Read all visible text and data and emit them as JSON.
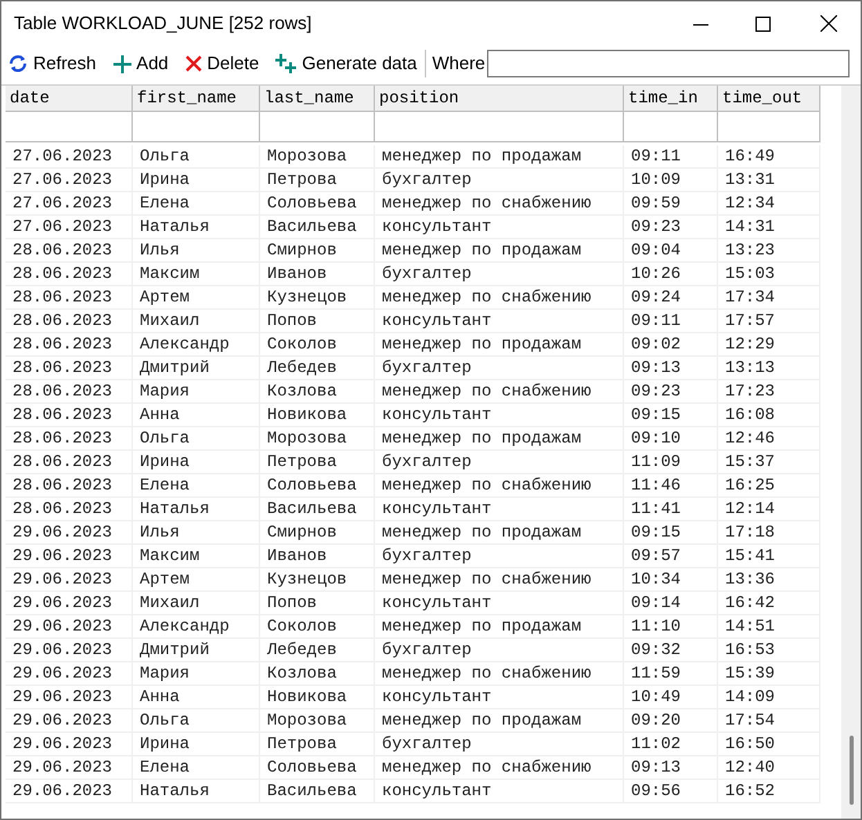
{
  "window": {
    "title": "Table WORKLOAD_JUNE [252 rows]"
  },
  "toolbar": {
    "buttons": [
      {
        "kind": "refresh",
        "label": "Refresh"
      },
      {
        "kind": "add",
        "label": "Add"
      },
      {
        "kind": "delete",
        "label": "Delete"
      },
      {
        "kind": "generate",
        "label": "Generate data"
      }
    ],
    "where_label": "Where"
  },
  "table": {
    "columns": [
      "date",
      "first_name",
      "last_name",
      "position",
      "time_in",
      "time_out"
    ],
    "rows": [
      [
        "27.06.2023",
        "Ольга",
        "Морозова",
        "менеджер по продажам",
        "09:11",
        "16:49"
      ],
      [
        "27.06.2023",
        "Ирина",
        "Петрова",
        "бухгалтер",
        "10:09",
        "13:31"
      ],
      [
        "27.06.2023",
        "Елена",
        "Соловьева",
        "менеджер по снабжению",
        "09:59",
        "12:34"
      ],
      [
        "27.06.2023",
        "Наталья",
        "Васильева",
        "консультант",
        "09:23",
        "14:31"
      ],
      [
        "28.06.2023",
        "Илья",
        "Смирнов",
        "менеджер по продажам",
        "09:04",
        "13:23"
      ],
      [
        "28.06.2023",
        "Максим",
        "Иванов",
        "бухгалтер",
        "10:26",
        "15:03"
      ],
      [
        "28.06.2023",
        "Артем",
        "Кузнецов",
        "менеджер по снабжению",
        "09:24",
        "17:34"
      ],
      [
        "28.06.2023",
        "Михаил",
        "Попов",
        "консультант",
        "09:11",
        "17:57"
      ],
      [
        "28.06.2023",
        "Александр",
        "Соколов",
        "менеджер по продажам",
        "09:02",
        "12:29"
      ],
      [
        "28.06.2023",
        "Дмитрий",
        "Лебедев",
        "бухгалтер",
        "09:13",
        "13:13"
      ],
      [
        "28.06.2023",
        "Мария",
        "Козлова",
        "менеджер по снабжению",
        "09:23",
        "17:23"
      ],
      [
        "28.06.2023",
        "Анна",
        "Новикова",
        "консультант",
        "09:15",
        "16:08"
      ],
      [
        "28.06.2023",
        "Ольга",
        "Морозова",
        "менеджер по продажам",
        "09:10",
        "12:46"
      ],
      [
        "28.06.2023",
        "Ирина",
        "Петрова",
        "бухгалтер",
        "11:09",
        "15:37"
      ],
      [
        "28.06.2023",
        "Елена",
        "Соловьева",
        "менеджер по снабжению",
        "11:46",
        "16:25"
      ],
      [
        "28.06.2023",
        "Наталья",
        "Васильева",
        "консультант",
        "11:41",
        "12:14"
      ],
      [
        "29.06.2023",
        "Илья",
        "Смирнов",
        "менеджер по продажам",
        "09:15",
        "17:18"
      ],
      [
        "29.06.2023",
        "Максим",
        "Иванов",
        "бухгалтер",
        "09:57",
        "15:41"
      ],
      [
        "29.06.2023",
        "Артем",
        "Кузнецов",
        "менеджер по снабжению",
        "10:34",
        "13:36"
      ],
      [
        "29.06.2023",
        "Михаил",
        "Попов",
        "консультант",
        "09:14",
        "16:42"
      ],
      [
        "29.06.2023",
        "Александр",
        "Соколов",
        "менеджер по продажам",
        "11:10",
        "14:51"
      ],
      [
        "29.06.2023",
        "Дмитрий",
        "Лебедев",
        "бухгалтер",
        "09:32",
        "16:53"
      ],
      [
        "29.06.2023",
        "Мария",
        "Козлова",
        "менеджер по снабжению",
        "11:59",
        "15:39"
      ],
      [
        "29.06.2023",
        "Анна",
        "Новикова",
        "консультант",
        "10:49",
        "14:09"
      ],
      [
        "29.06.2023",
        "Ольга",
        "Морозова",
        "менеджер по продажам",
        "09:20",
        "17:54"
      ],
      [
        "29.06.2023",
        "Ирина",
        "Петрова",
        "бухгалтер",
        "11:02",
        "16:50"
      ],
      [
        "29.06.2023",
        "Елена",
        "Соловьева",
        "менеджер по снабжению",
        "09:13",
        "12:40"
      ],
      [
        "29.06.2023",
        "Наталья",
        "Васильева",
        "консультант",
        "09:56",
        "16:52"
      ]
    ]
  }
}
